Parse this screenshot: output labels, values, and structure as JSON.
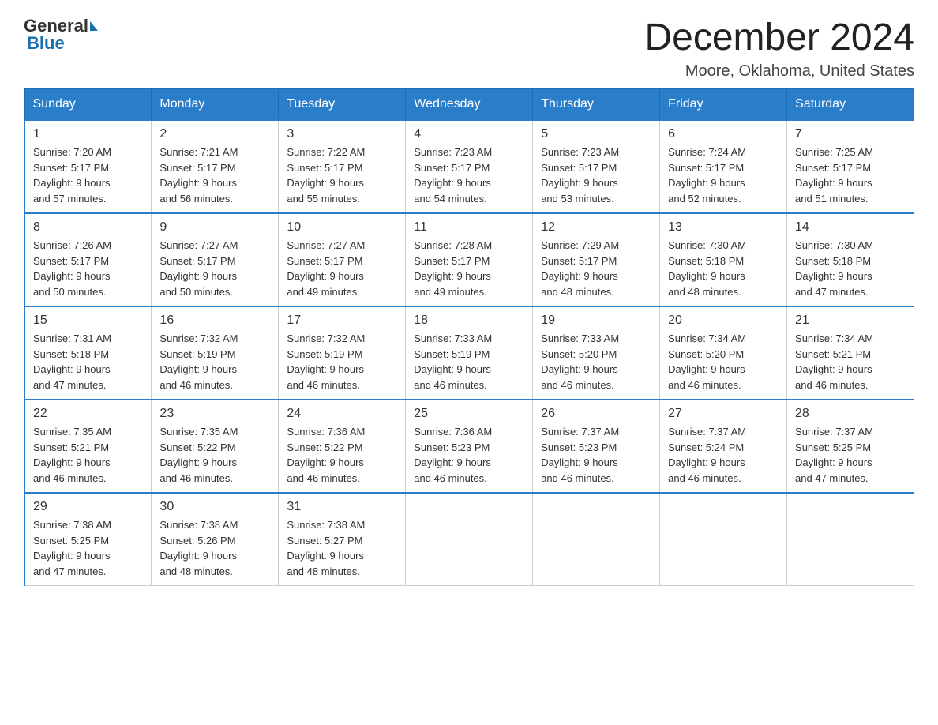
{
  "header": {
    "title": "December 2024",
    "subtitle": "Moore, Oklahoma, United States",
    "logo_general": "General",
    "logo_blue": "Blue"
  },
  "days_of_week": [
    "Sunday",
    "Monday",
    "Tuesday",
    "Wednesday",
    "Thursday",
    "Friday",
    "Saturday"
  ],
  "weeks": [
    [
      {
        "day": "1",
        "sunrise": "7:20 AM",
        "sunset": "5:17 PM",
        "daylight": "9 hours and 57 minutes."
      },
      {
        "day": "2",
        "sunrise": "7:21 AM",
        "sunset": "5:17 PM",
        "daylight": "9 hours and 56 minutes."
      },
      {
        "day": "3",
        "sunrise": "7:22 AM",
        "sunset": "5:17 PM",
        "daylight": "9 hours and 55 minutes."
      },
      {
        "day": "4",
        "sunrise": "7:23 AM",
        "sunset": "5:17 PM",
        "daylight": "9 hours and 54 minutes."
      },
      {
        "day": "5",
        "sunrise": "7:23 AM",
        "sunset": "5:17 PM",
        "daylight": "9 hours and 53 minutes."
      },
      {
        "day": "6",
        "sunrise": "7:24 AM",
        "sunset": "5:17 PM",
        "daylight": "9 hours and 52 minutes."
      },
      {
        "day": "7",
        "sunrise": "7:25 AM",
        "sunset": "5:17 PM",
        "daylight": "9 hours and 51 minutes."
      }
    ],
    [
      {
        "day": "8",
        "sunrise": "7:26 AM",
        "sunset": "5:17 PM",
        "daylight": "9 hours and 50 minutes."
      },
      {
        "day": "9",
        "sunrise": "7:27 AM",
        "sunset": "5:17 PM",
        "daylight": "9 hours and 50 minutes."
      },
      {
        "day": "10",
        "sunrise": "7:27 AM",
        "sunset": "5:17 PM",
        "daylight": "9 hours and 49 minutes."
      },
      {
        "day": "11",
        "sunrise": "7:28 AM",
        "sunset": "5:17 PM",
        "daylight": "9 hours and 49 minutes."
      },
      {
        "day": "12",
        "sunrise": "7:29 AM",
        "sunset": "5:17 PM",
        "daylight": "9 hours and 48 minutes."
      },
      {
        "day": "13",
        "sunrise": "7:30 AM",
        "sunset": "5:18 PM",
        "daylight": "9 hours and 48 minutes."
      },
      {
        "day": "14",
        "sunrise": "7:30 AM",
        "sunset": "5:18 PM",
        "daylight": "9 hours and 47 minutes."
      }
    ],
    [
      {
        "day": "15",
        "sunrise": "7:31 AM",
        "sunset": "5:18 PM",
        "daylight": "9 hours and 47 minutes."
      },
      {
        "day": "16",
        "sunrise": "7:32 AM",
        "sunset": "5:19 PM",
        "daylight": "9 hours and 46 minutes."
      },
      {
        "day": "17",
        "sunrise": "7:32 AM",
        "sunset": "5:19 PM",
        "daylight": "9 hours and 46 minutes."
      },
      {
        "day": "18",
        "sunrise": "7:33 AM",
        "sunset": "5:19 PM",
        "daylight": "9 hours and 46 minutes."
      },
      {
        "day": "19",
        "sunrise": "7:33 AM",
        "sunset": "5:20 PM",
        "daylight": "9 hours and 46 minutes."
      },
      {
        "day": "20",
        "sunrise": "7:34 AM",
        "sunset": "5:20 PM",
        "daylight": "9 hours and 46 minutes."
      },
      {
        "day": "21",
        "sunrise": "7:34 AM",
        "sunset": "5:21 PM",
        "daylight": "9 hours and 46 minutes."
      }
    ],
    [
      {
        "day": "22",
        "sunrise": "7:35 AM",
        "sunset": "5:21 PM",
        "daylight": "9 hours and 46 minutes."
      },
      {
        "day": "23",
        "sunrise": "7:35 AM",
        "sunset": "5:22 PM",
        "daylight": "9 hours and 46 minutes."
      },
      {
        "day": "24",
        "sunrise": "7:36 AM",
        "sunset": "5:22 PM",
        "daylight": "9 hours and 46 minutes."
      },
      {
        "day": "25",
        "sunrise": "7:36 AM",
        "sunset": "5:23 PM",
        "daylight": "9 hours and 46 minutes."
      },
      {
        "day": "26",
        "sunrise": "7:37 AM",
        "sunset": "5:23 PM",
        "daylight": "9 hours and 46 minutes."
      },
      {
        "day": "27",
        "sunrise": "7:37 AM",
        "sunset": "5:24 PM",
        "daylight": "9 hours and 46 minutes."
      },
      {
        "day": "28",
        "sunrise": "7:37 AM",
        "sunset": "5:25 PM",
        "daylight": "9 hours and 47 minutes."
      }
    ],
    [
      {
        "day": "29",
        "sunrise": "7:38 AM",
        "sunset": "5:25 PM",
        "daylight": "9 hours and 47 minutes."
      },
      {
        "day": "30",
        "sunrise": "7:38 AM",
        "sunset": "5:26 PM",
        "daylight": "9 hours and 48 minutes."
      },
      {
        "day": "31",
        "sunrise": "7:38 AM",
        "sunset": "5:27 PM",
        "daylight": "9 hours and 48 minutes."
      },
      null,
      null,
      null,
      null
    ]
  ],
  "labels": {
    "sunrise": "Sunrise:",
    "sunset": "Sunset:",
    "daylight": "Daylight:"
  }
}
